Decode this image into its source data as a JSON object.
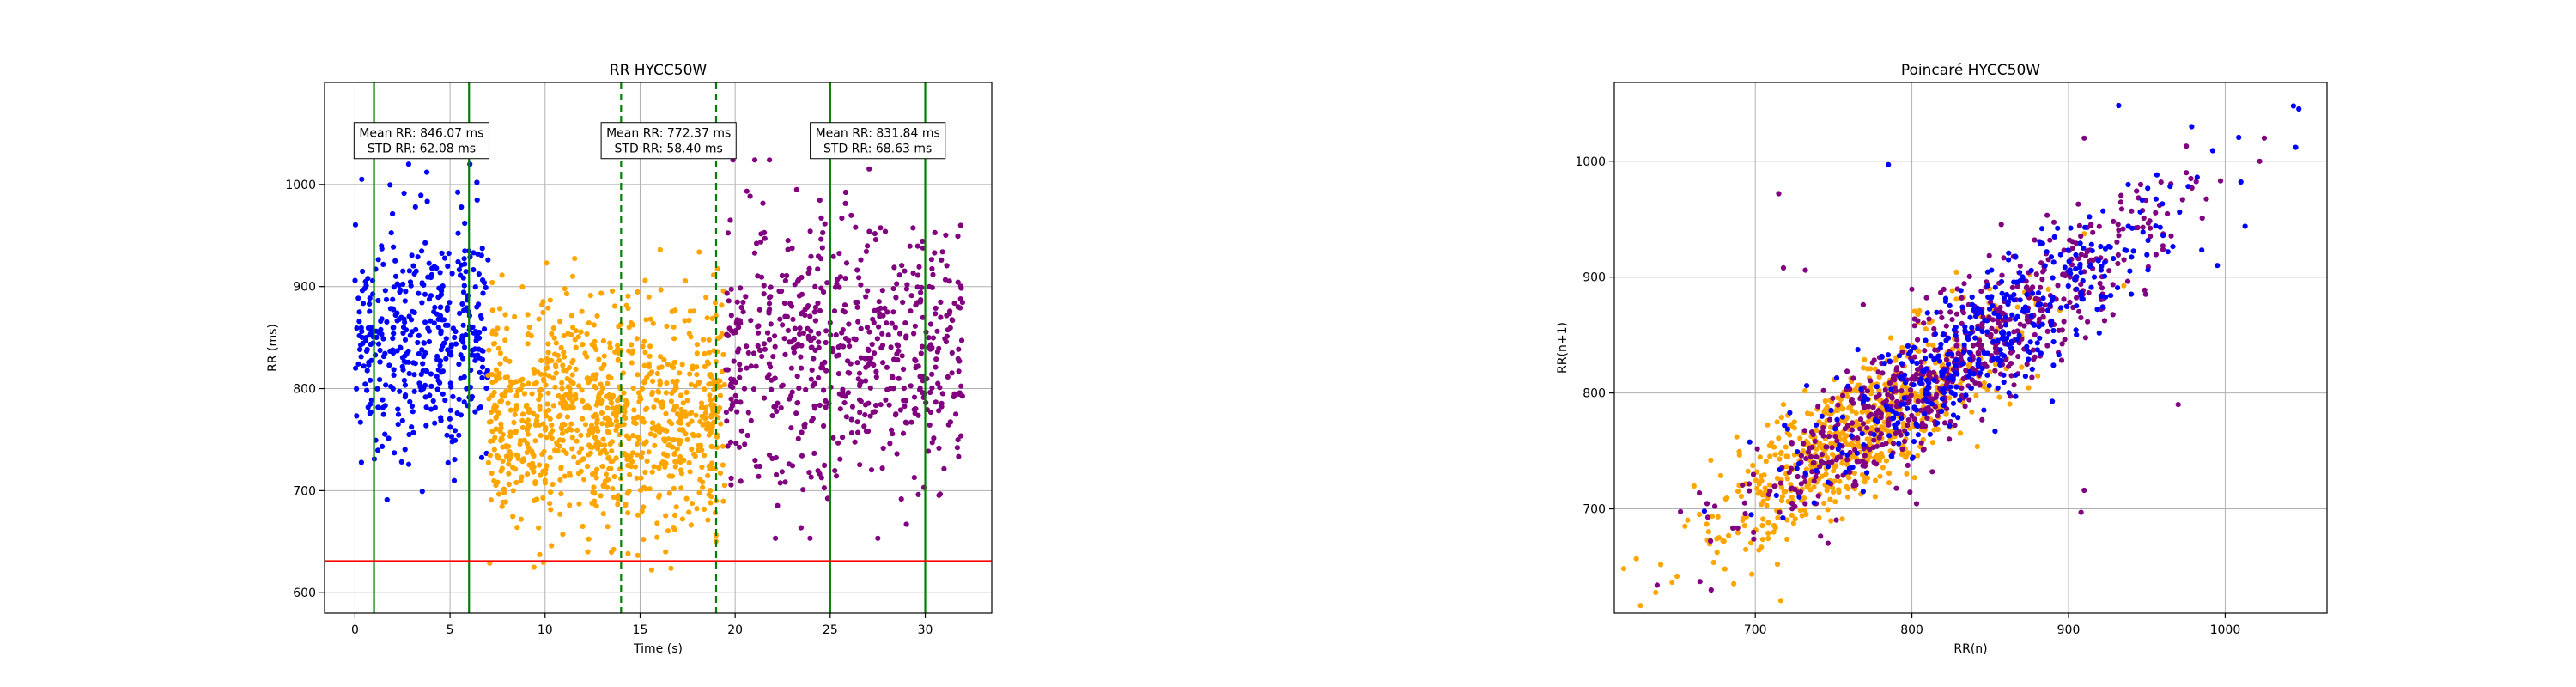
{
  "colors": {
    "phase1": "#0000ff",
    "phase2": "#ffa500",
    "phase3": "#800080",
    "vline_solid": "#008000",
    "vline_dashed": "#008000",
    "threshold": "#ff0000",
    "grid": "#b0b0b0"
  },
  "chart_data": [
    {
      "type": "scatter",
      "title": "RR HYCC50W",
      "xlabel": "Time (s)",
      "ylabel": "RR (ms)",
      "xlim": [
        -1.6,
        33.5
      ],
      "ylim": [
        580,
        1100
      ],
      "xticks": [
        0,
        5,
        10,
        15,
        20,
        25,
        30
      ],
      "yticks": [
        600,
        700,
        800,
        900,
        1000
      ],
      "xtick_labels": [
        "0",
        "5",
        "10",
        "15",
        "20",
        "25",
        "30"
      ],
      "ytick_labels": [
        "600",
        "700",
        "800",
        "900",
        "1000"
      ],
      "grid": true,
      "legend": "none",
      "series": [
        {
          "color": "#0000ff",
          "time_range": [
            0,
            7
          ],
          "mean": 846.07,
          "std": 62.08,
          "approx_points": 430
        },
        {
          "color": "#ffa500",
          "time_range": [
            7,
            19.5
          ],
          "mean": 772.37,
          "std": 58.4,
          "approx_points": 950
        },
        {
          "color": "#800080",
          "time_range": [
            19.5,
            32
          ],
          "mean": 831.84,
          "std": 68.63,
          "approx_points": 620
        }
      ],
      "vlines": [
        {
          "x": 1,
          "style": "solid",
          "color": "#008000"
        },
        {
          "x": 6,
          "style": "solid",
          "color": "#008000"
        },
        {
          "x": 14,
          "style": "dashed",
          "color": "#008000"
        },
        {
          "x": 19,
          "style": "dashed",
          "color": "#008000"
        },
        {
          "x": 25,
          "style": "solid",
          "color": "#008000"
        },
        {
          "x": 30,
          "style": "solid",
          "color": "#008000"
        }
      ],
      "hline": {
        "y": 631,
        "color": "#ff0000"
      },
      "annotations": [
        {
          "x": 3.5,
          "y": 1043,
          "line1": "Mean RR: 846.07 ms",
          "line2": "STD RR: 62.08 ms"
        },
        {
          "x": 16.5,
          "y": 1043,
          "line1": "Mean RR: 772.37 ms",
          "line2": "STD RR: 58.40 ms"
        },
        {
          "x": 27.5,
          "y": 1043,
          "line1": "Mean RR: 831.84 ms",
          "line2": "STD RR: 68.63 ms"
        }
      ]
    },
    {
      "type": "scatter",
      "title": "Poincaré HYCC50W",
      "xlabel": "RR(n)",
      "ylabel": "RR(n+1)",
      "xlim": [
        610,
        1065
      ],
      "ylim": [
        610,
        1068
      ],
      "xticks": [
        700,
        800,
        900,
        1000
      ],
      "yticks": [
        700,
        800,
        900,
        1000
      ],
      "xtick_labels": [
        "700",
        "800",
        "900",
        "1000"
      ],
      "ytick_labels": [
        "700",
        "800",
        "900",
        "1000"
      ],
      "grid": true,
      "legend": "none",
      "series": [
        {
          "color": "#ffa500",
          "center": 765,
          "spread": 45,
          "approx_points": 700
        },
        {
          "color": "#800080",
          "center": 825,
          "spread": 65,
          "approx_points": 700
        },
        {
          "color": "#0000ff",
          "center": 845,
          "spread": 55,
          "approx_points": 420
        }
      ],
      "outliers": [
        {
          "x": 1047,
          "y": 1045,
          "color": "#0000ff"
        },
        {
          "x": 1045,
          "y": 1012,
          "color": "#0000ff"
        },
        {
          "x": 1025,
          "y": 1020,
          "color": "#800080"
        },
        {
          "x": 1022,
          "y": 1000,
          "color": "#800080"
        },
        {
          "x": 932,
          "y": 1048,
          "color": "#0000ff"
        },
        {
          "x": 910,
          "y": 1020,
          "color": "#800080"
        },
        {
          "x": 785,
          "y": 997,
          "color": "#0000ff"
        },
        {
          "x": 715,
          "y": 972,
          "color": "#800080"
        },
        {
          "x": 718,
          "y": 908,
          "color": "#800080"
        },
        {
          "x": 732,
          "y": 906,
          "color": "#800080"
        },
        {
          "x": 910,
          "y": 716,
          "color": "#800080"
        },
        {
          "x": 908,
          "y": 697,
          "color": "#800080"
        },
        {
          "x": 970,
          "y": 790,
          "color": "#800080"
        },
        {
          "x": 997,
          "y": 983,
          "color": "#800080"
        },
        {
          "x": 1010,
          "y": 982,
          "color": "#0000ff"
        },
        {
          "x": 995,
          "y": 910,
          "color": "#0000ff"
        }
      ]
    }
  ]
}
